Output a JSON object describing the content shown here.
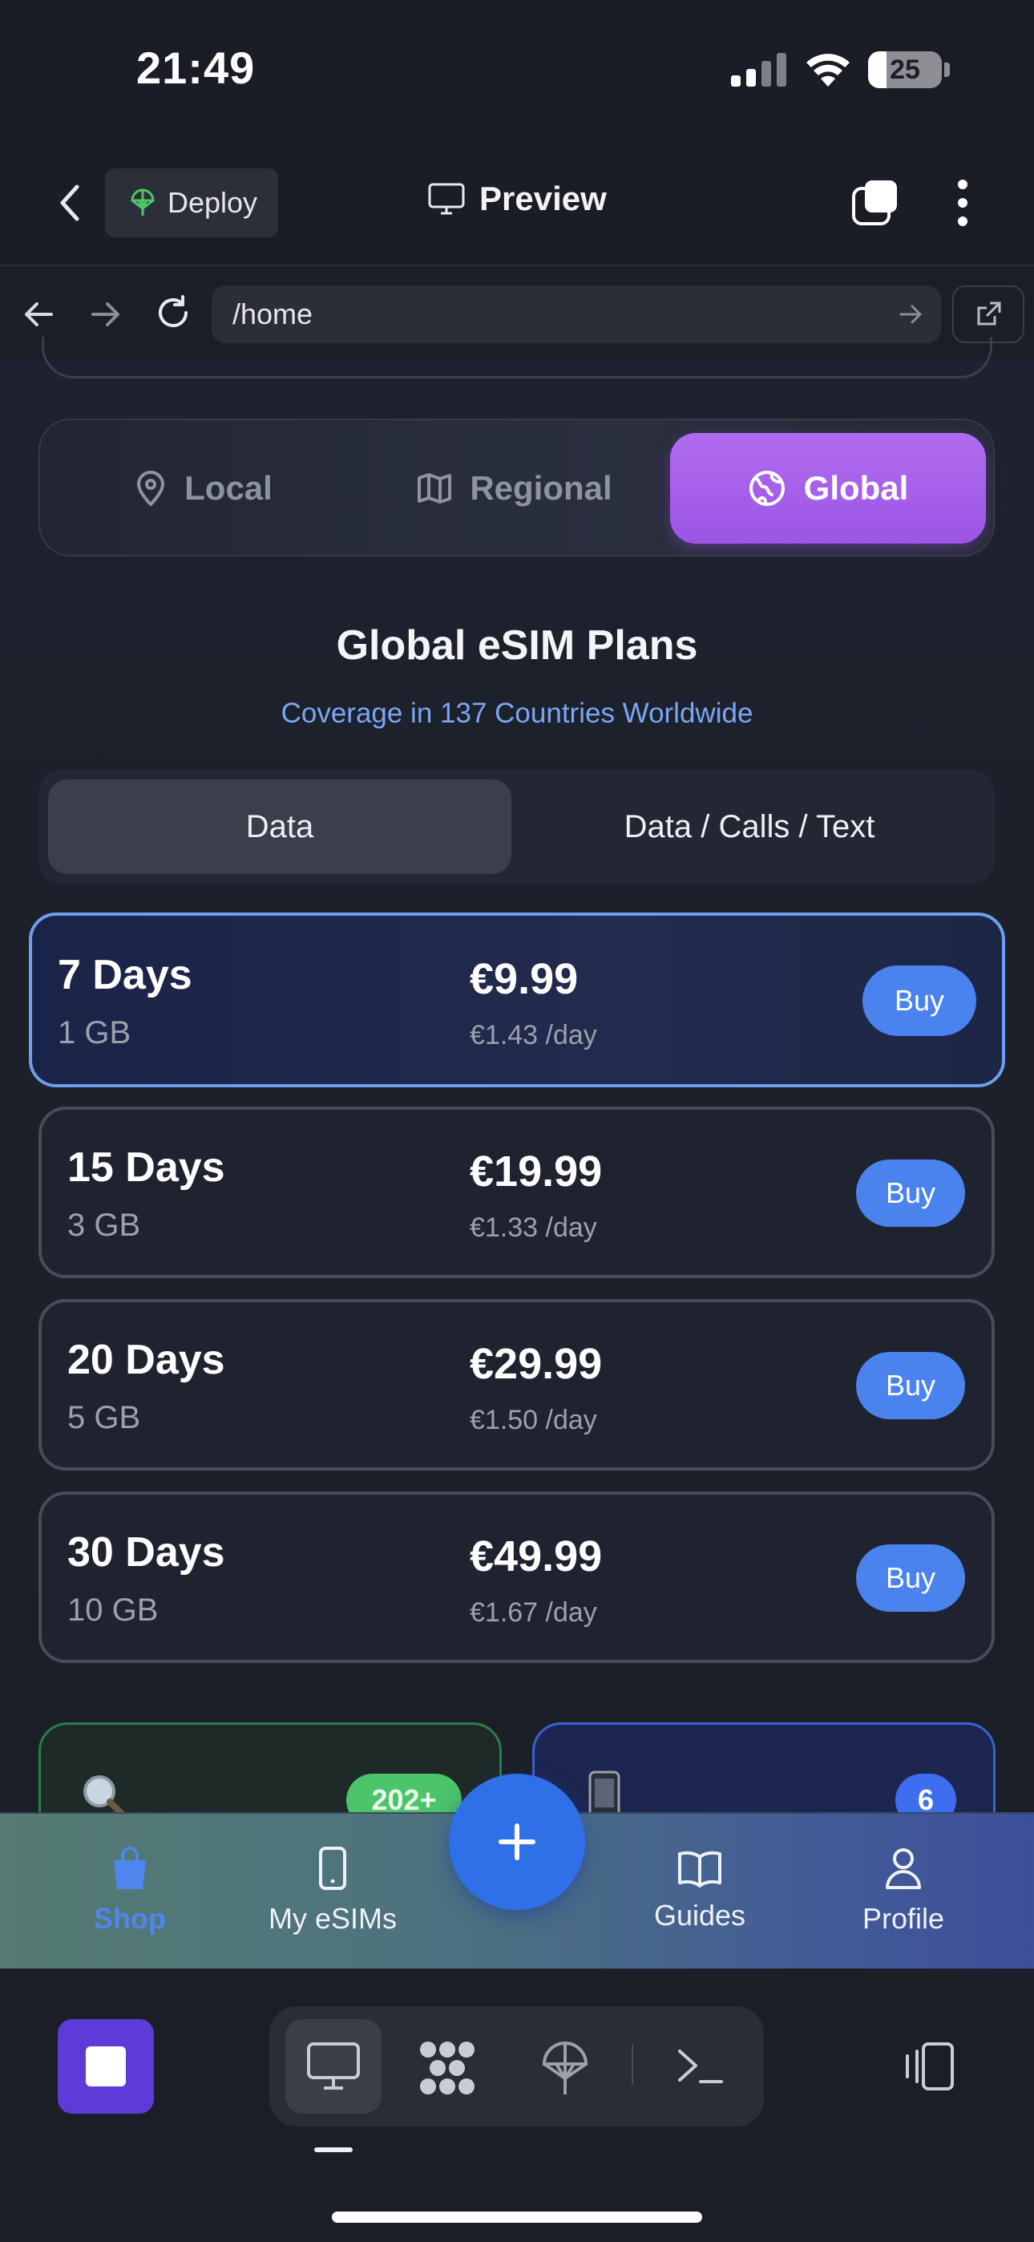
{
  "status_bar": {
    "time": "21:49",
    "battery": "25",
    "battery_level": 0.25
  },
  "header": {
    "deploy_label": "Deploy",
    "preview_label": "Preview"
  },
  "browser": {
    "url": "/home"
  },
  "region_tabs": [
    {
      "label": "Local",
      "icon": "map-pin-icon",
      "active": false
    },
    {
      "label": "Regional",
      "icon": "map-icon",
      "active": false
    },
    {
      "label": "Global",
      "icon": "globe-icon",
      "active": true
    }
  ],
  "plans": {
    "title": "Global eSIM Plans",
    "subtitle": "Coverage in 137 Countries Worldwide",
    "type_tabs": [
      {
        "label": "Data",
        "active": true
      },
      {
        "label": "Data / Calls / Text",
        "active": false
      }
    ],
    "items": [
      {
        "days": "7 Days",
        "data": "1 GB",
        "price": "€9.99",
        "per_day": "€1.43 /day",
        "buy_label": "Buy",
        "selected": true
      },
      {
        "days": "15 Days",
        "data": "3 GB",
        "price": "€19.99",
        "per_day": "€1.33 /day",
        "buy_label": "Buy",
        "selected": false
      },
      {
        "days": "20 Days",
        "data": "5 GB",
        "price": "€29.99",
        "per_day": "€1.50 /day",
        "buy_label": "Buy",
        "selected": false
      },
      {
        "days": "30 Days",
        "data": "10 GB",
        "price": "€49.99",
        "per_day": "€1.67 /day",
        "buy_label": "Buy",
        "selected": false
      }
    ]
  },
  "info_cards": {
    "countries_badge": "202+",
    "esims_badge": "6"
  },
  "bottom_nav": {
    "items": [
      {
        "label": "Shop",
        "icon": "shopping-bag-icon",
        "active": true
      },
      {
        "label": "My eSIMs",
        "icon": "smartphone-icon",
        "active": false
      },
      {
        "label": "Guides",
        "icon": "book-icon",
        "active": false
      },
      {
        "label": "Profile",
        "icon": "user-icon",
        "active": false
      }
    ],
    "fab_label": "+"
  },
  "colors": {
    "accent_purple": "#a763ee",
    "accent_blue": "#4a82ee",
    "link_blue": "#7aa6f2",
    "badge_green": "#4cc469"
  }
}
